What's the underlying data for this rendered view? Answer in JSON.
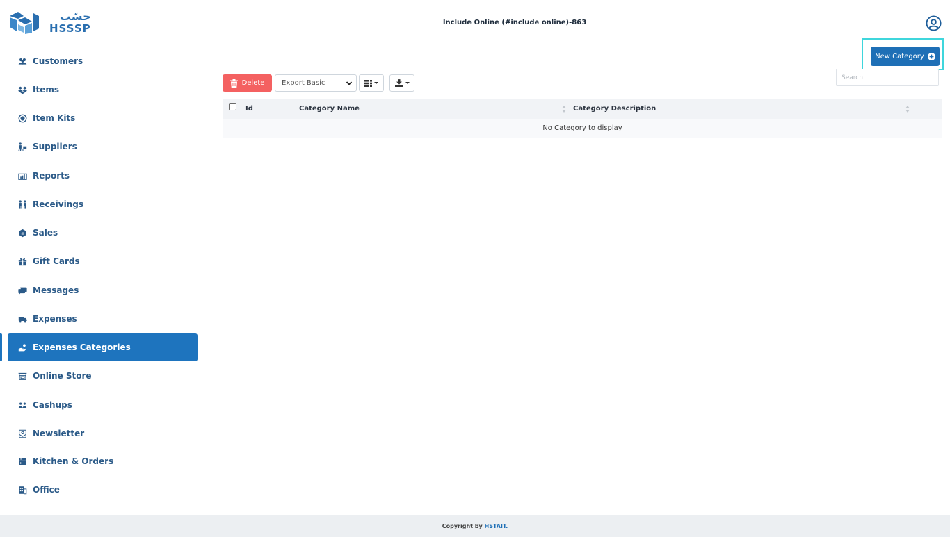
{
  "logo": {
    "arabic": "حسّب",
    "english": "HSSSP"
  },
  "header": {
    "title": "Include Online (#include online)-863"
  },
  "sidebar": {
    "items": [
      {
        "label": "Customers",
        "icon": "users-icon"
      },
      {
        "label": "Items",
        "icon": "dropbox-icon"
      },
      {
        "label": "Item Kits",
        "icon": "kit-icon"
      },
      {
        "label": "Suppliers",
        "icon": "supplier-icon"
      },
      {
        "label": "Reports",
        "icon": "reports-icon"
      },
      {
        "label": "Receivings",
        "icon": "receivings-icon"
      },
      {
        "label": "Sales",
        "icon": "sales-icon"
      },
      {
        "label": "Gift Cards",
        "icon": "gift-icon"
      },
      {
        "label": "Messages",
        "icon": "messages-icon"
      },
      {
        "label": "Expenses",
        "icon": "expenses-icon"
      },
      {
        "label": "Expenses Categories",
        "icon": "expenses-categories-icon",
        "active": true
      },
      {
        "label": "Online Store",
        "icon": "store-icon"
      },
      {
        "label": "Cashups",
        "icon": "cashups-icon"
      },
      {
        "label": "Newsletter",
        "icon": "newsletter-icon"
      },
      {
        "label": "Kitchen & Orders",
        "icon": "kitchen-icon"
      },
      {
        "label": "Office",
        "icon": "office-icon"
      }
    ]
  },
  "toolbar": {
    "new_category_label": "New Category",
    "delete_label": "Delete",
    "export_selected": "Export Basic",
    "search_placeholder": "Search"
  },
  "table": {
    "columns": [
      "Id",
      "Category Name",
      "Category Description"
    ],
    "empty_message": "No Category to display"
  },
  "footer": {
    "prefix": "Copyright by ",
    "brand": "HSTAIT."
  },
  "colors": {
    "primary": "#1e74be",
    "danger": "#f46161",
    "highlight": "#3fd6dc",
    "nav_text": "#2b5a88"
  }
}
